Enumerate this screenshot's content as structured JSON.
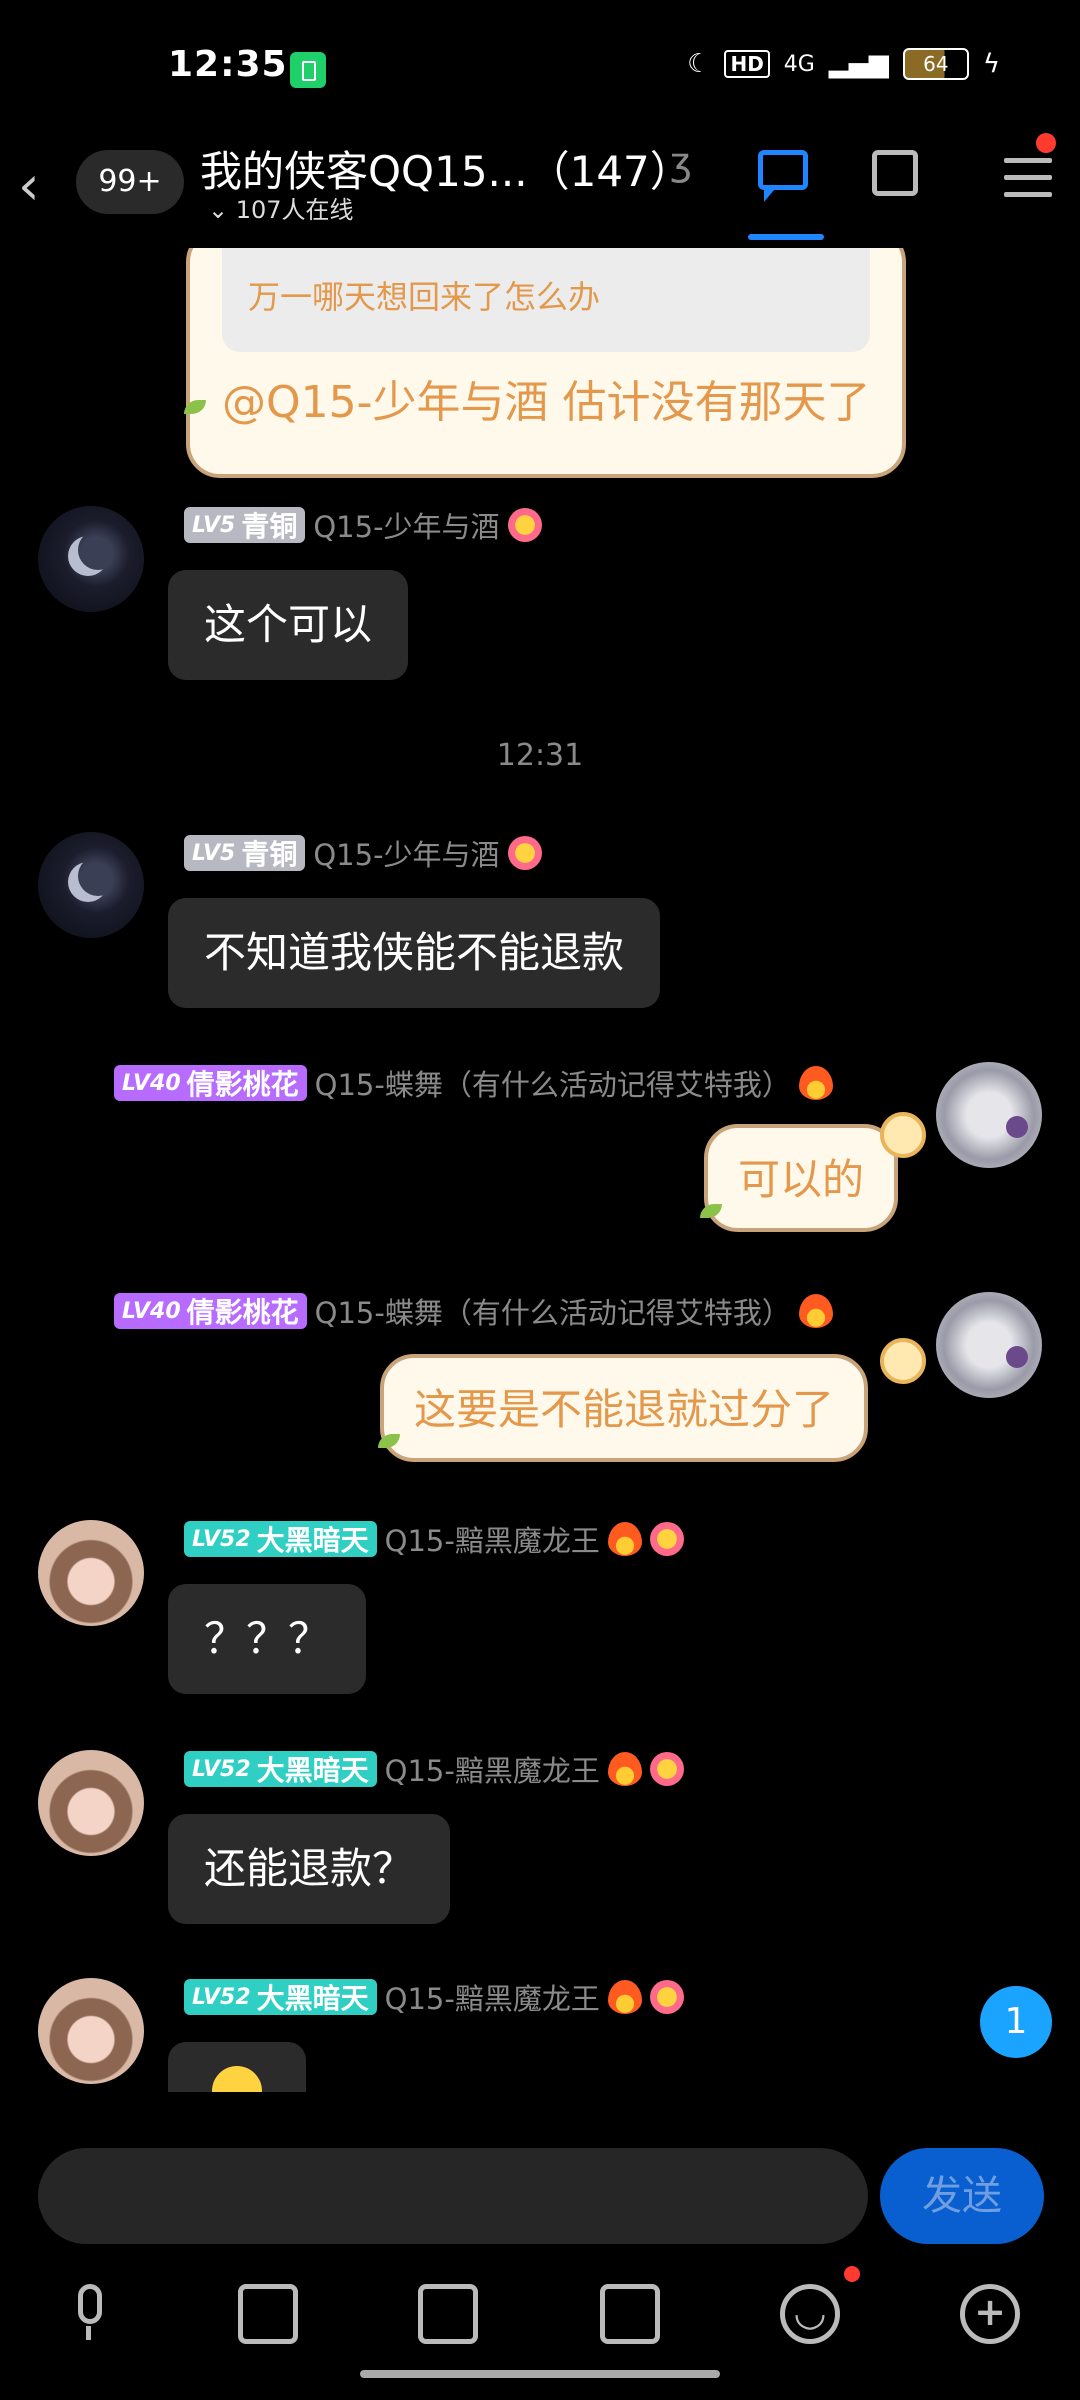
{
  "status": {
    "time": "12:35",
    "hd": "HD",
    "network": "4G",
    "battery": "64"
  },
  "nav": {
    "unread_badge": "99+",
    "title": "我的侠客QQ15...（147）",
    "online": "107人在线"
  },
  "quote": {
    "quoted_text": "万一哪天想回来了怎么办",
    "reply_text": "@Q15-少年与酒 估计没有那天了"
  },
  "level_badges": {
    "lv5": "LV5",
    "lv5_title": "青铜",
    "lv40": "LV40",
    "lv40_title": "倩影桃花",
    "lv52": "LV52",
    "lv52_title": "大黑暗天"
  },
  "nicknames": {
    "shaonian": "Q15-少年与酒",
    "diewu": "Q15-蝶舞（有什么活动记得艾特我）",
    "molong": "Q15-黯黑魔龙王"
  },
  "messages": {
    "m1": "这个可以",
    "time_sep": "12:31",
    "m2": "不知道我侠能不能退款",
    "m3": "可以的",
    "m4": "这要是不能退就过分了",
    "m5": "？？？",
    "m6": "还能退款？"
  },
  "unread_new": "1",
  "input": {
    "placeholder": "",
    "send_label": "发送"
  },
  "colors": {
    "accent": "#1f86ff",
    "fancy_text": "#e3984b",
    "send_bg": "#0a5fd0"
  }
}
